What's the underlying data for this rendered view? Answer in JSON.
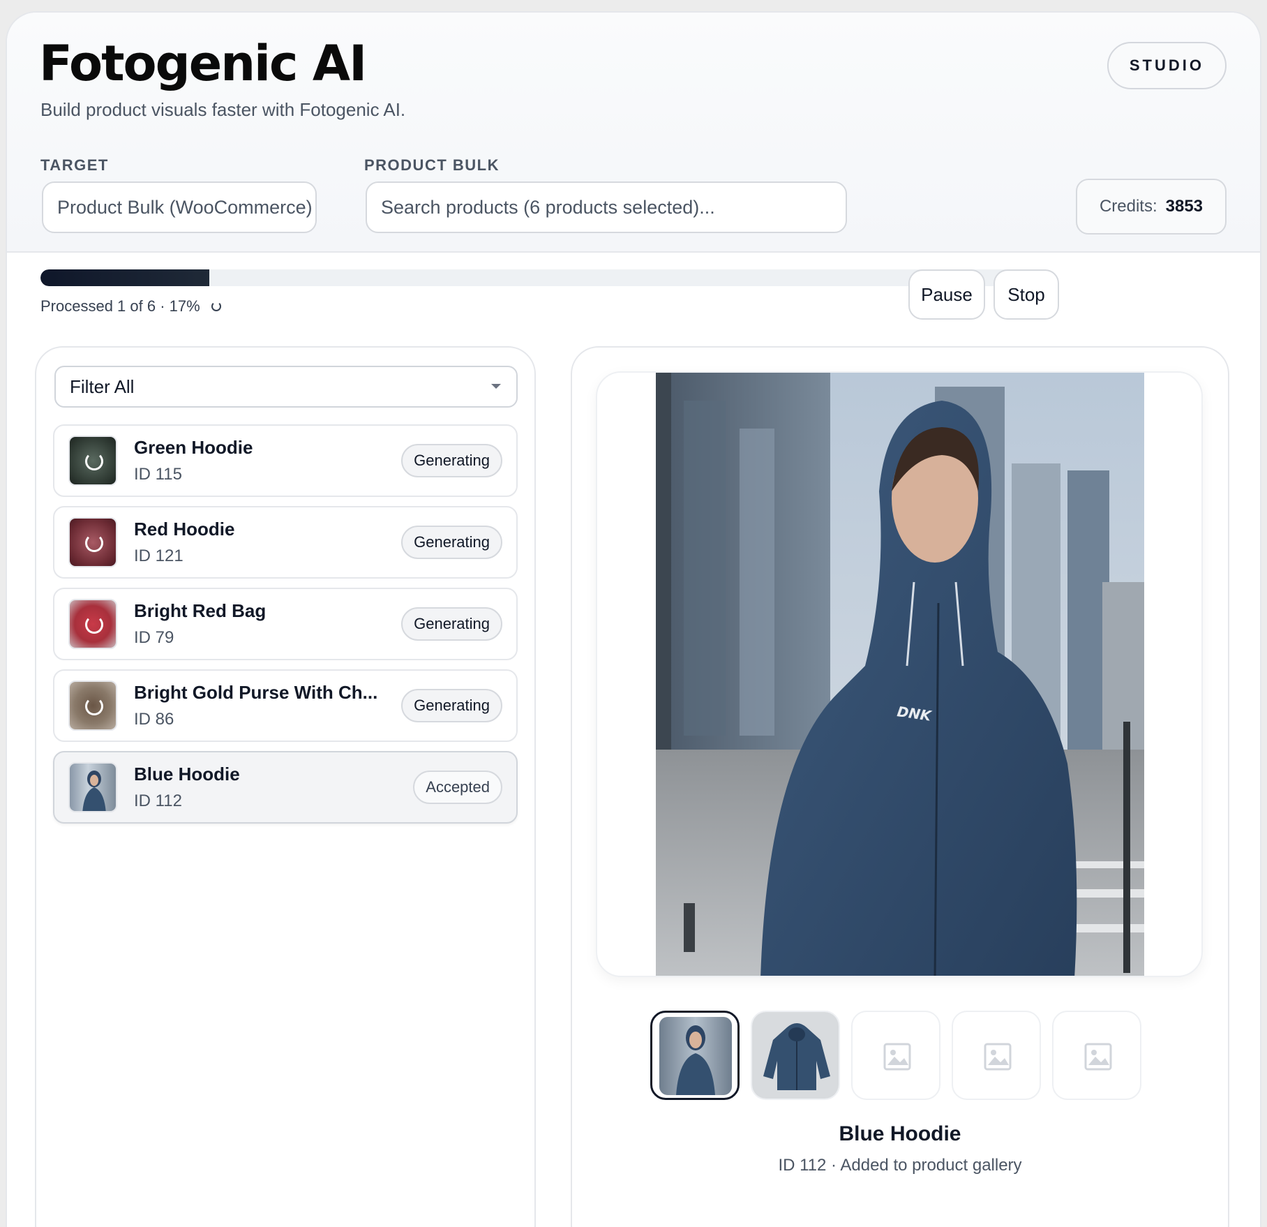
{
  "app": {
    "title": "Fotogenic AI",
    "tagline": "Build product visuals faster with Fotogenic AI.",
    "mode": "STUDIO"
  },
  "target": {
    "label": "TARGET",
    "value": "Product Bulk (WooCommerce)"
  },
  "bulk": {
    "label": "PRODUCT BULK",
    "placeholder": "Search products (6 products selected)..."
  },
  "credits": {
    "label": "Credits:",
    "value": "3853"
  },
  "progress": {
    "text": "Processed 1 of 6 · 17%",
    "fraction": 0.17
  },
  "controls": {
    "pause": "Pause",
    "stop": "Stop"
  },
  "filter": {
    "selected": "Filter All"
  },
  "items": [
    {
      "name": "Green Hoodie",
      "id": "ID 115",
      "status": "Generating",
      "tint": "#2f3a33"
    },
    {
      "name": "Red Hoodie",
      "id": "ID 121",
      "status": "Generating",
      "tint": "#6b2a33"
    },
    {
      "name": "Bright Red Bag",
      "id": "ID 79",
      "status": "Generating",
      "tint": "#a8303c"
    },
    {
      "name": "Bright Gold Purse With Ch...",
      "id": "ID 86",
      "status": "Generating",
      "tint": "#7a6a5a"
    },
    {
      "name": "Blue Hoodie",
      "id": "ID 112",
      "status": "Accepted",
      "tint": "#2f4a6a"
    }
  ],
  "detail": {
    "name": "Blue Hoodie",
    "subtitle": "ID 112 · Added to product gallery",
    "logo_text": "DNK"
  },
  "colors": {
    "accent": "#111827",
    "hoodie": "#34506f"
  }
}
